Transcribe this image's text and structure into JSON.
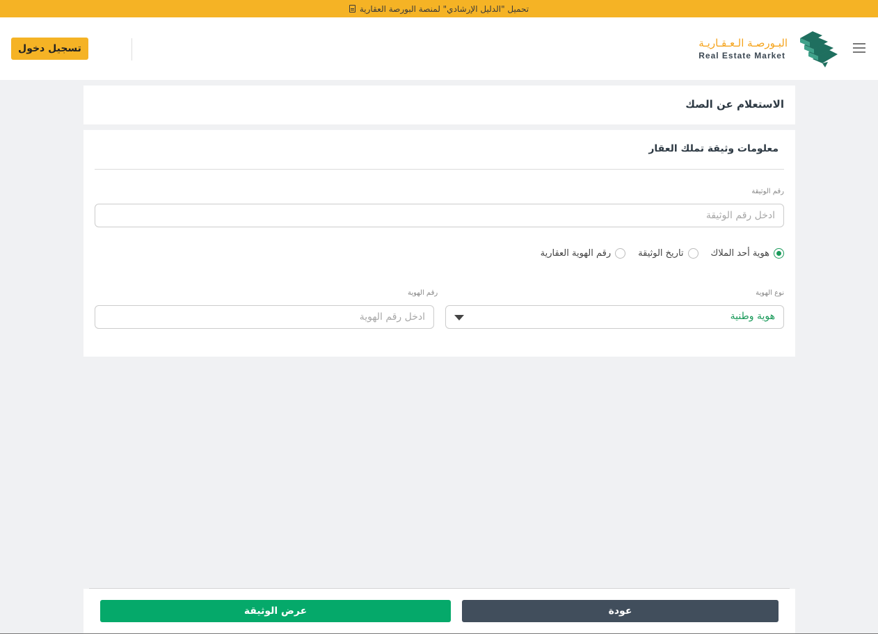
{
  "banner": {
    "text": "تحميل \"الدليل الإرشادي\" لمنصة البورصة العقارية",
    "icon": "pdf-file-icon"
  },
  "header": {
    "logo_ar": "البـورصـة الـعـقـاريـة",
    "logo_en": "Real Estate Market",
    "login_label": "تسجيل دخول",
    "brand_colors": {
      "gold": "#f5b325",
      "green": "#1f6f5f"
    }
  },
  "page": {
    "title": "الاستعلام عن الصك"
  },
  "form": {
    "section_title": "معلومات وثيقة تملك العقار",
    "doc_number": {
      "label": "رقم الوثيقة",
      "placeholder": "ادخل رقم الوثيقة",
      "value": ""
    },
    "search_by": {
      "options": [
        "هوية أحد الملاك",
        "تاريخ الوثيقة",
        "رقم الهوية العقارية"
      ],
      "selected": "هوية أحد الملاك"
    },
    "id_type": {
      "label": "نوع الهوية",
      "value": "هوية وطنية"
    },
    "id_number": {
      "label": "رقم الهوية",
      "placeholder": "ادخل رقم الهوية",
      "value": ""
    }
  },
  "footer": {
    "view_label": "عرض الوثيقة",
    "back_label": "عودة",
    "view_color": "#05a96a",
    "back_color": "#414e5c"
  }
}
